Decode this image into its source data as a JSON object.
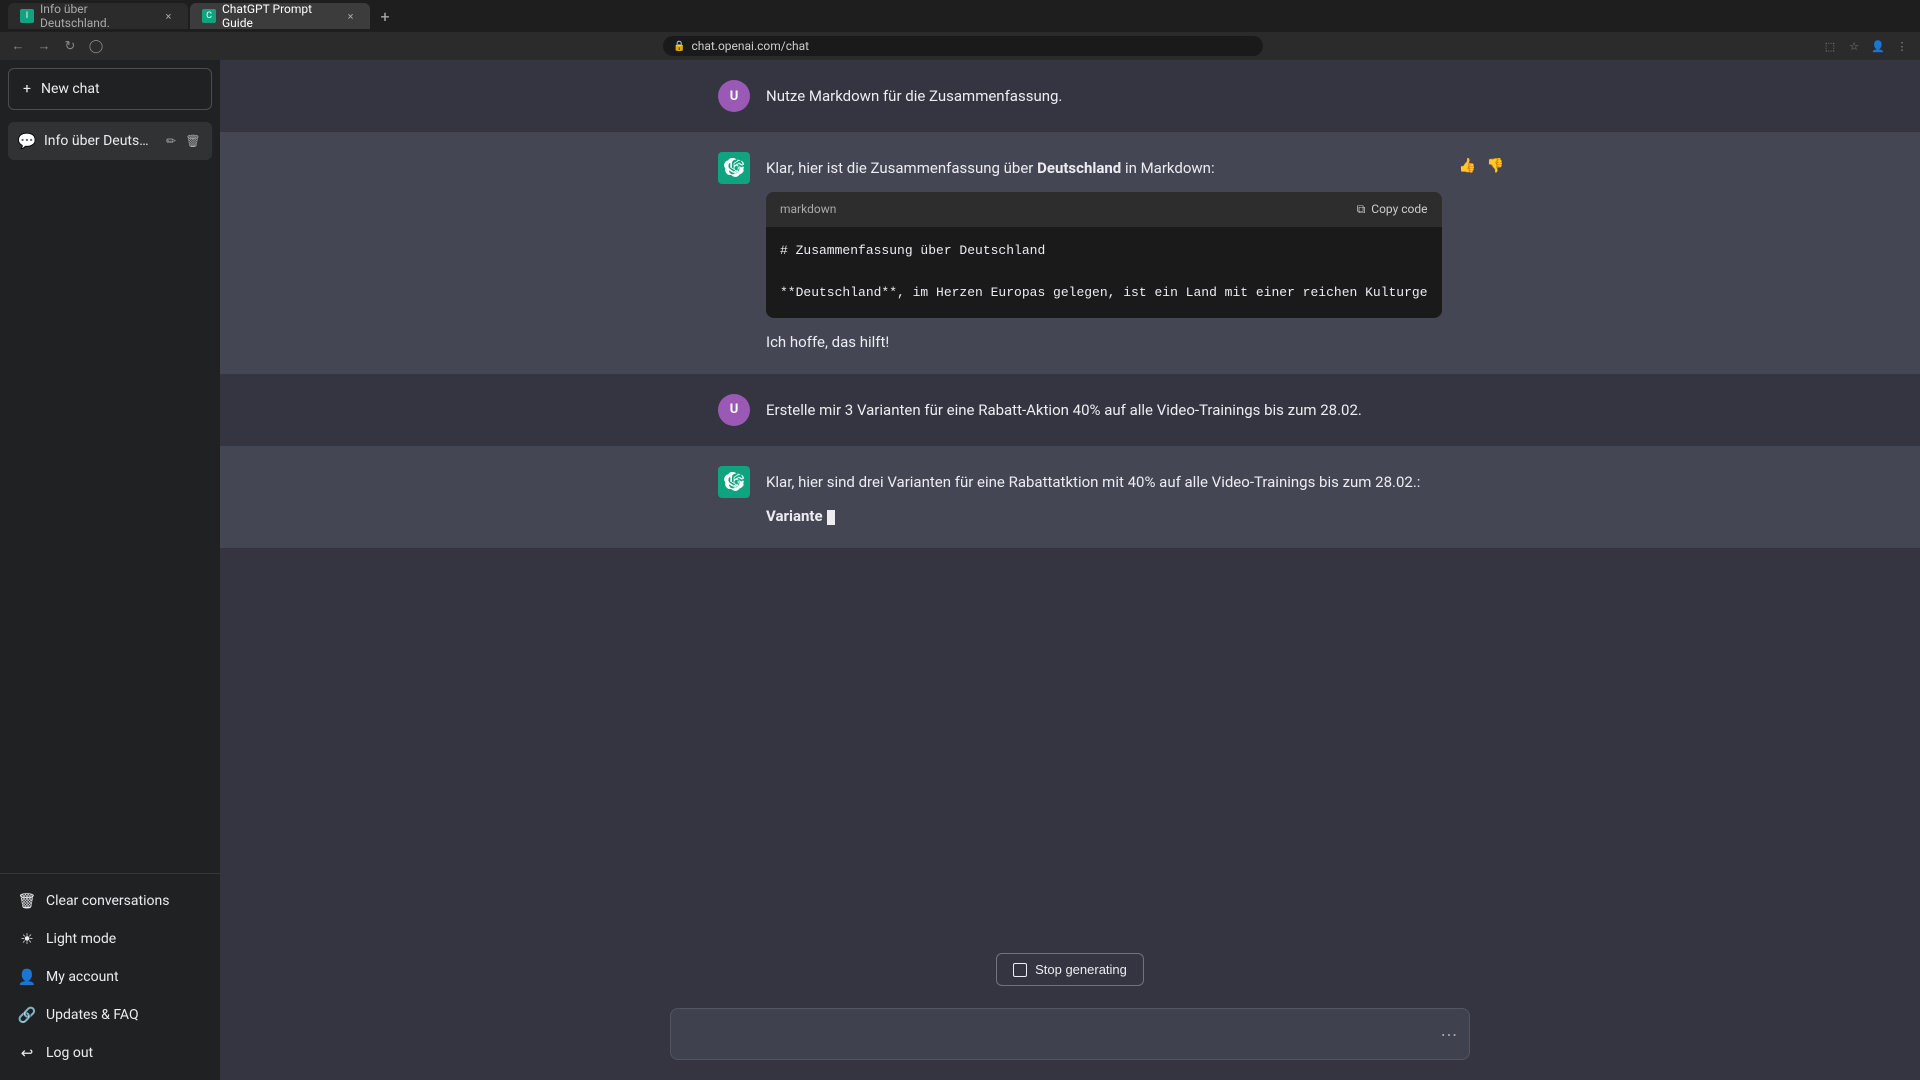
{
  "browser": {
    "tabs": [
      {
        "id": "tab1",
        "title": "Info über Deutschland.",
        "favicon": "I",
        "active": false,
        "url": ""
      },
      {
        "id": "tab2",
        "title": "ChatGPT Prompt Guide",
        "favicon": "C",
        "active": true,
        "url": "chat.openai.com/chat"
      }
    ],
    "address": "chat.openai.com/chat"
  },
  "sidebar": {
    "new_chat_label": "New chat",
    "chat_item": {
      "title": "Info über Deutschland.",
      "icon": "💬"
    },
    "bottom_items": [
      {
        "id": "clear",
        "label": "Clear conversations",
        "icon": "🗑"
      },
      {
        "id": "light",
        "label": "Light mode",
        "icon": "☀"
      },
      {
        "id": "account",
        "label": "My account",
        "icon": "👤"
      },
      {
        "id": "updates",
        "label": "Updates & FAQ",
        "icon": "🔗"
      },
      {
        "id": "logout",
        "label": "Log out",
        "icon": "⬔"
      }
    ]
  },
  "chat": {
    "messages": [
      {
        "id": "msg1",
        "role": "user",
        "text": "Nutze Markdown für die Zusammenfassung."
      },
      {
        "id": "msg2",
        "role": "assistant",
        "text_before": "Klar, hier ist die Zusammenfassung über ",
        "bold_word": "Deutschland",
        "text_after": " in Markdown:",
        "code_block": {
          "lang": "markdown",
          "copy_label": "Copy code",
          "line1": "# Zusammenfassung über Deutschland",
          "line2": "",
          "line3": "**Deutschland**, im Herzen Europas gelegen, ist ein Land mit einer reichen Kulturge"
        },
        "footer": "Ich hoffe, das hilft!"
      },
      {
        "id": "msg3",
        "role": "user",
        "text": "Erstelle mir 3 Varianten für eine Rabatt-Aktion 40% auf alle Video-Trainings bis zum 28.02."
      },
      {
        "id": "msg4",
        "role": "assistant",
        "text_before": "Klar, hier sind drei Varianten für eine Rabattatktion mit 40% auf alle Video-Trainings bis zum 28.02.:",
        "streaming_text": "**Variante "
      }
    ],
    "stop_generating_label": "Stop generating",
    "input_placeholder": ""
  }
}
